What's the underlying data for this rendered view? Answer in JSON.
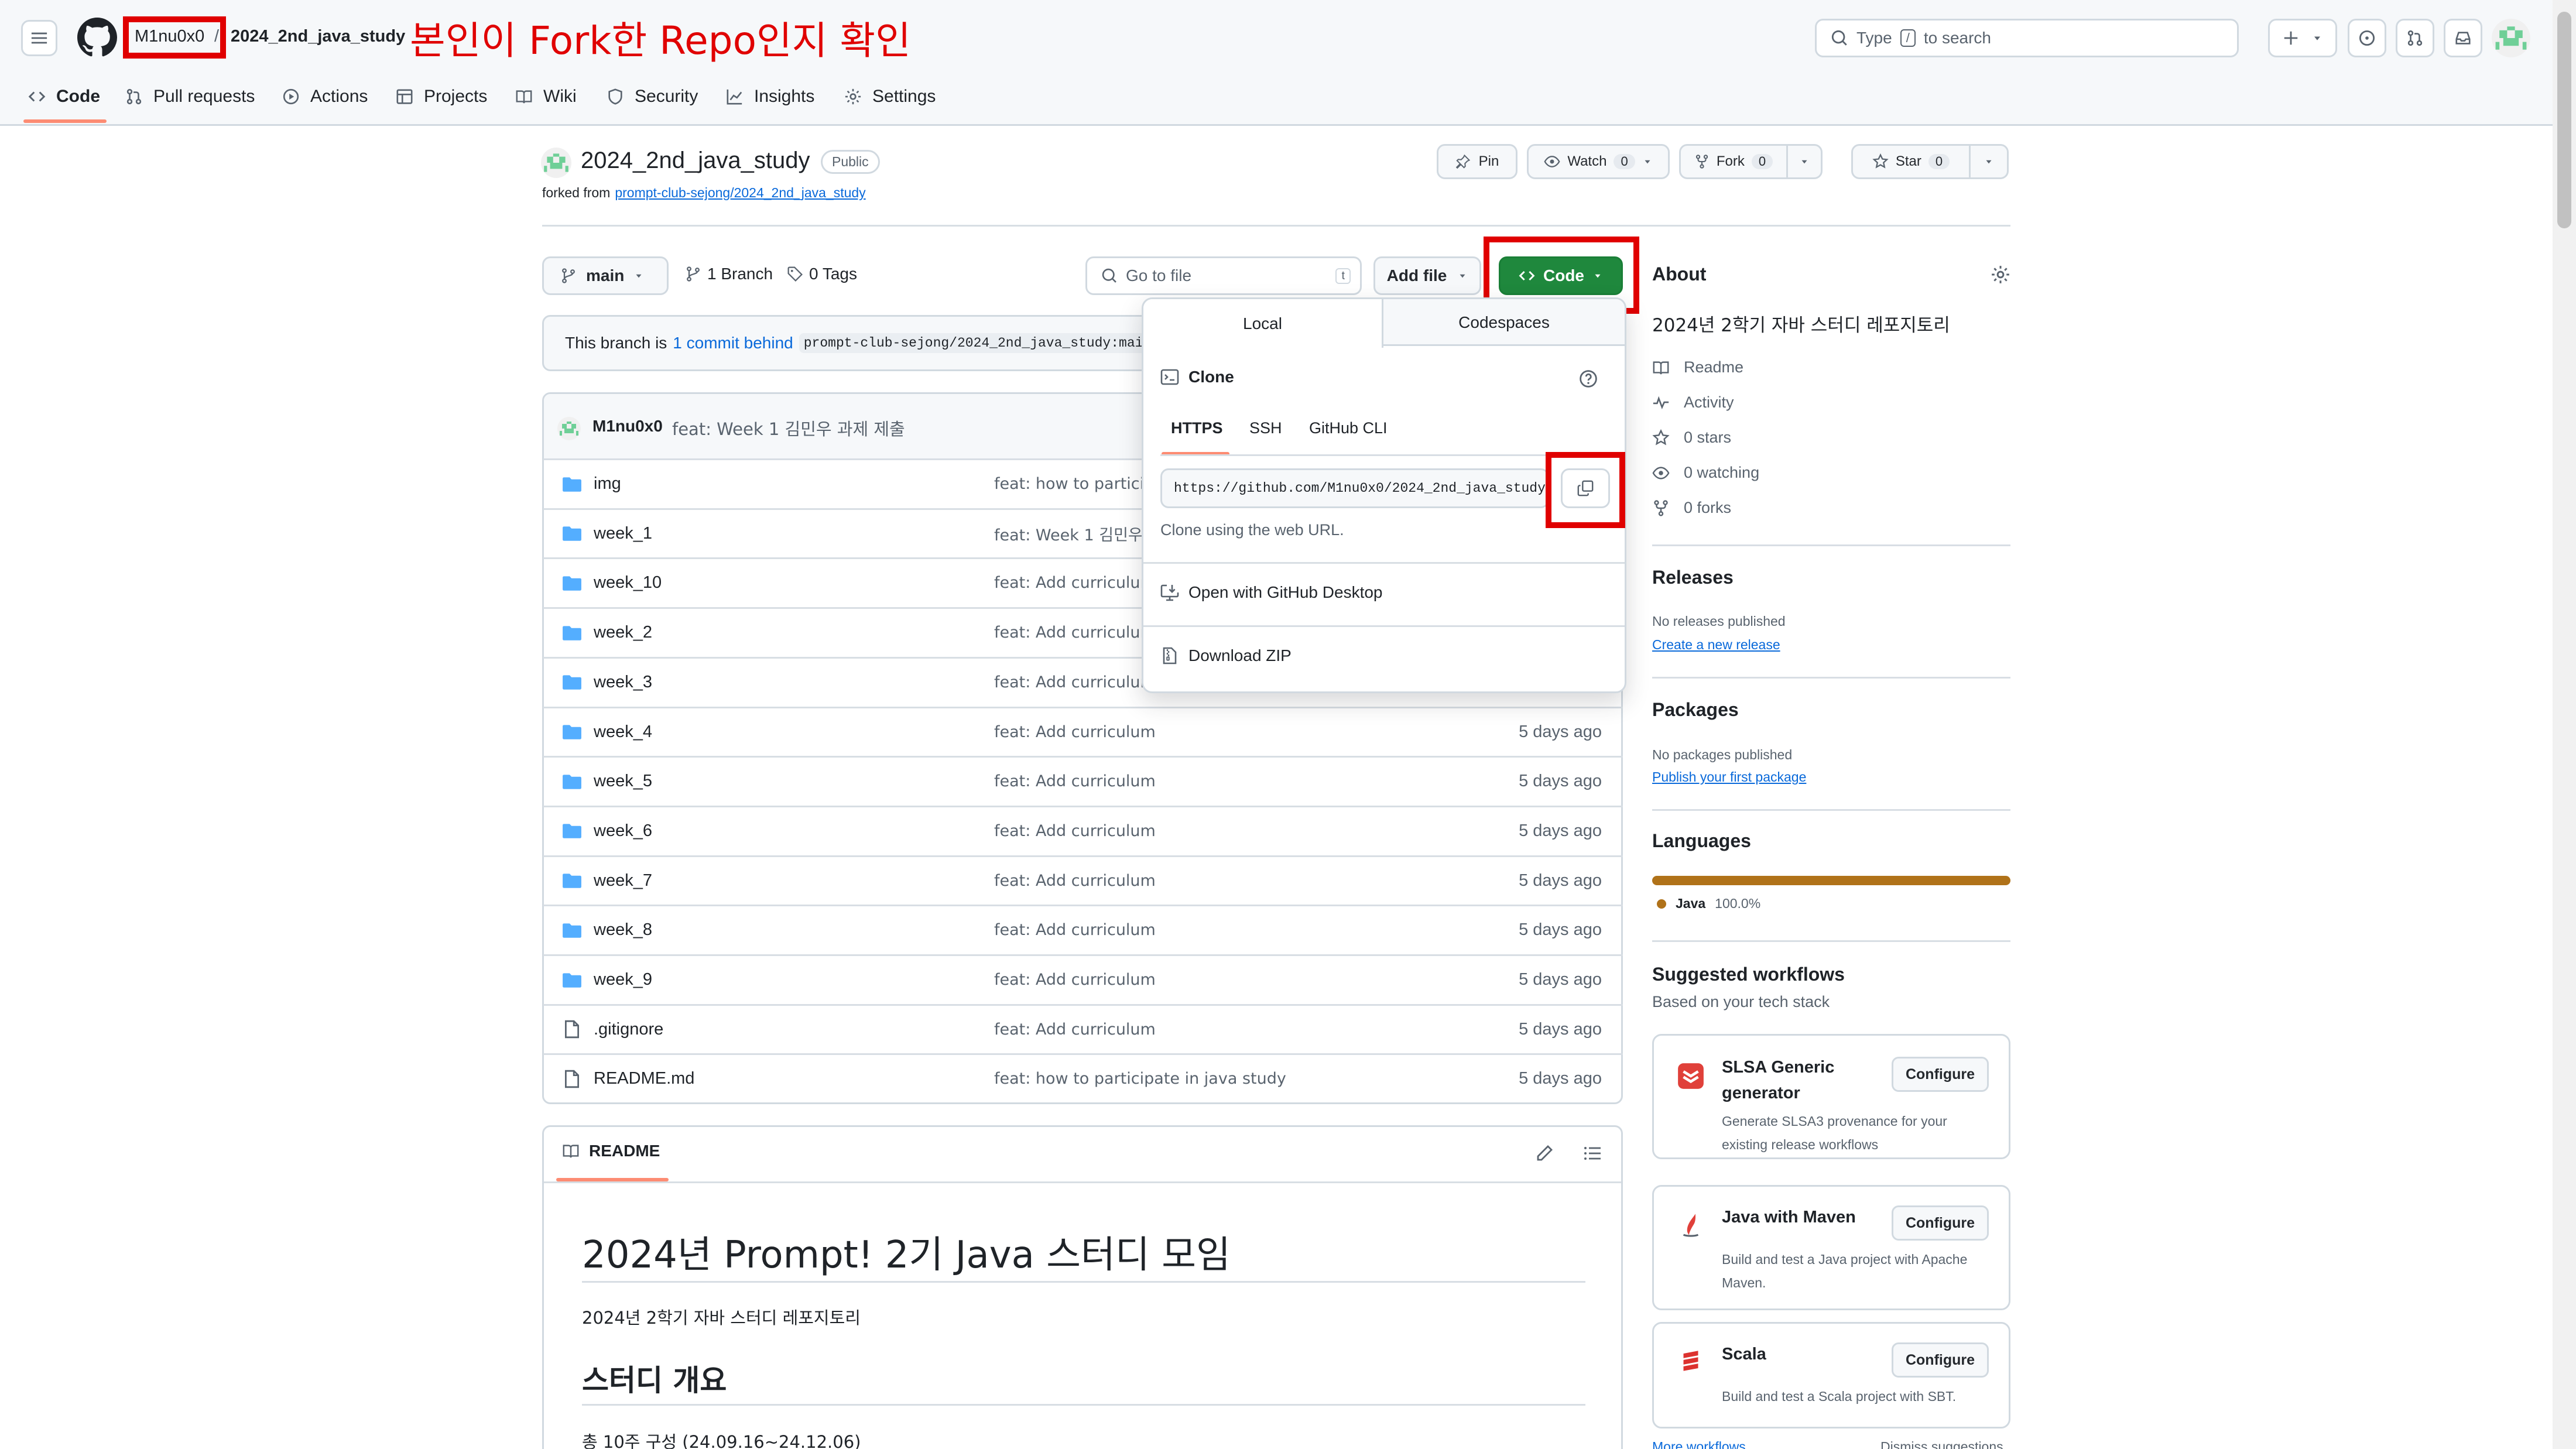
{
  "header": {
    "owner": "M1nu0x0",
    "slash": "/",
    "repo": "2024_2nd_java_study",
    "annotation": "본인이 Fork한 Repo인지 확인",
    "search_prefix": "Type",
    "search_key": "/",
    "search_suffix": "to search"
  },
  "nav": {
    "tabs": [
      {
        "label": "Code",
        "icon": "code-icon",
        "active": true
      },
      {
        "label": "Pull requests",
        "icon": "pull-request-icon"
      },
      {
        "label": "Actions",
        "icon": "play-icon"
      },
      {
        "label": "Projects",
        "icon": "table-icon"
      },
      {
        "label": "Wiki",
        "icon": "book-icon"
      },
      {
        "label": "Security",
        "icon": "shield-icon"
      },
      {
        "label": "Insights",
        "icon": "graph-icon"
      },
      {
        "label": "Settings",
        "icon": "gear-icon"
      }
    ]
  },
  "repo": {
    "name": "2024_2nd_java_study",
    "visibility": "Public",
    "forked_prefix": "forked from",
    "forked_from": "prompt-club-sejong/2024_2nd_java_study",
    "pin": "Pin",
    "watch": "Watch",
    "watch_count": "0",
    "fork": "Fork",
    "fork_count": "0",
    "star": "Star",
    "star_count": "0"
  },
  "toolbar": {
    "branch": "main",
    "branch_count": "1 Branch",
    "tag_count": "0 Tags",
    "goto_placeholder": "Go to file",
    "goto_key": "t",
    "add_file": "Add file",
    "code": "Code"
  },
  "behind": {
    "prefix": "This branch is",
    "link": "1 commit behind",
    "ref": "prompt-club-sejong/2024_2nd_java_study:main"
  },
  "commit": {
    "author": "M1nu0x0",
    "message": "feat: Week 1 김민우 과제 제출"
  },
  "files": [
    {
      "name": "img",
      "type": "dir",
      "msg": "feat: how to participate in java study",
      "age": ""
    },
    {
      "name": "week_1",
      "type": "dir",
      "msg": "feat: Week 1 김민우 과제 제출",
      "age": ""
    },
    {
      "name": "week_10",
      "type": "dir",
      "msg": "feat: Add curriculum",
      "age": ""
    },
    {
      "name": "week_2",
      "type": "dir",
      "msg": "feat: Add curriculum",
      "age": ""
    },
    {
      "name": "week_3",
      "type": "dir",
      "msg": "feat: Add curriculum",
      "age": ""
    },
    {
      "name": "week_4",
      "type": "dir",
      "msg": "feat: Add curriculum",
      "age": "5 days ago"
    },
    {
      "name": "week_5",
      "type": "dir",
      "msg": "feat: Add curriculum",
      "age": "5 days ago"
    },
    {
      "name": "week_6",
      "type": "dir",
      "msg": "feat: Add curriculum",
      "age": "5 days ago"
    },
    {
      "name": "week_7",
      "type": "dir",
      "msg": "feat: Add curriculum",
      "age": "5 days ago"
    },
    {
      "name": "week_8",
      "type": "dir",
      "msg": "feat: Add curriculum",
      "age": "5 days ago"
    },
    {
      "name": "week_9",
      "type": "dir",
      "msg": "feat: Add curriculum",
      "age": "5 days ago"
    },
    {
      "name": ".gitignore",
      "type": "file",
      "msg": "feat: Add curriculum",
      "age": "5 days ago"
    },
    {
      "name": "README.md",
      "type": "file",
      "msg": "feat: how to participate in java study",
      "age": "5 days ago"
    }
  ],
  "readme": {
    "tab": "README",
    "h1": "2024년 Prompt! 2기 Java 스터디 모임",
    "desc": "2024년 2학기 자바 스터디 레포지토리",
    "h2": "스터디 개요",
    "line": "총 10주 구성 (24.09.16~24.12.06)"
  },
  "dropdown": {
    "tab_local": "Local",
    "tab_codespaces": "Codespaces",
    "clone": "Clone",
    "proto": [
      "HTTPS",
      "SSH",
      "GitHub CLI"
    ],
    "url": "https://github.com/M1nu0x0/2024_2nd_java_study",
    "url_hint": "Clone using the web URL.",
    "desktop": "Open with GitHub Desktop",
    "zip": "Download ZIP"
  },
  "about": {
    "title": "About",
    "desc": "2024년 2학기 자바 스터디 레포지토리",
    "items": [
      {
        "label": "Readme",
        "icon": "book-icon"
      },
      {
        "label": "Activity",
        "icon": "pulse-icon"
      },
      {
        "label": "0 stars",
        "icon": "star-icon"
      },
      {
        "label": "0 watching",
        "icon": "eye-icon"
      },
      {
        "label": "0 forks",
        "icon": "fork-icon"
      }
    ]
  },
  "releases": {
    "title": "Releases",
    "none": "No releases published",
    "link": "Create a new release"
  },
  "packages": {
    "title": "Packages",
    "none": "No packages published",
    "link": "Publish your first package"
  },
  "languages": {
    "title": "Languages",
    "name": "Java",
    "pct": "100.0%",
    "color": "#b07219"
  },
  "workflows": {
    "title": "Suggested workflows",
    "sub": "Based on your tech stack",
    "configure": "Configure",
    "items": [
      {
        "name": "SLSA Generic generator",
        "desc": "Generate SLSA3 provenance for your existing release workflows"
      },
      {
        "name": "Java with Maven",
        "desc": "Build and test a Java project with Apache Maven."
      },
      {
        "name": "Scala",
        "desc": "Build and test a Scala project with SBT."
      }
    ],
    "more": "More workflows",
    "dismiss": "Dismiss suggestions"
  }
}
